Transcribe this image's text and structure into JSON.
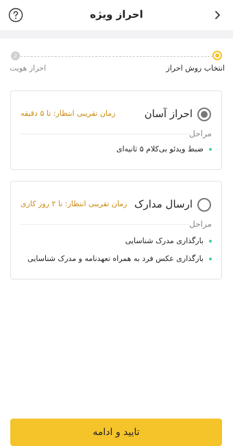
{
  "header": {
    "title": "احراز ویژه"
  },
  "stepper": {
    "steps": [
      {
        "label": "انتخاب روش احراز",
        "active": true
      },
      {
        "label": "احراز هویت",
        "number": "2",
        "active": false
      }
    ]
  },
  "options": [
    {
      "name": "احراز آسان",
      "wait_time": "زمان تقریبی انتظار: تا ۵ دقیقه",
      "selected": true,
      "steps_title": "مراحل",
      "steps": [
        "ضبط ویدئو بی‌کلام ۵ ثانیه‌ای"
      ]
    },
    {
      "name": "ارسال مدارک",
      "wait_time": "زمان تقریبی انتظار: تا ۲ روز کاری",
      "selected": false,
      "steps_title": "مراحل",
      "steps": [
        "بارگذاری مدرک شناسایی",
        "بارگذاری عکس فرد به همراه تعهدنامه و مدرک شناسایی"
      ]
    }
  ],
  "footer": {
    "confirm_label": "تایید و ادامه"
  },
  "colors": {
    "accent": "#f5c32a",
    "wait_text": "#c98a12",
    "bullet": "#3ccfa0"
  }
}
